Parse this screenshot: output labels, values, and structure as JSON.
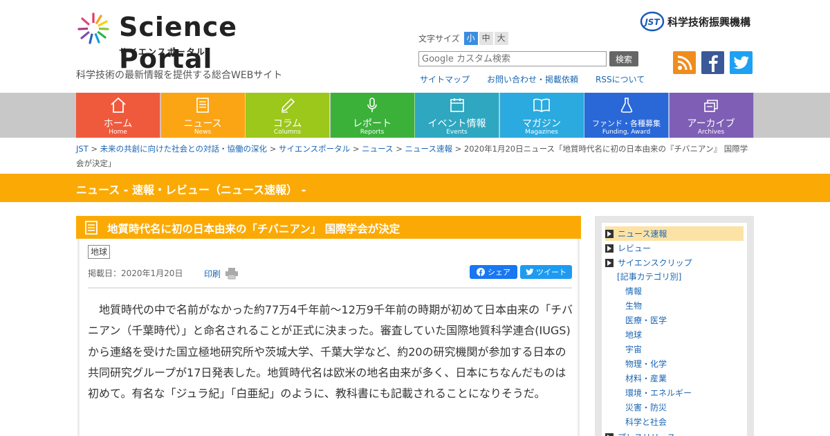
{
  "header": {
    "logo_text": "Science Portal",
    "logo_kana": "サイエンスポータル",
    "tagline": "科学技術の最新情報を提供する総合WEBサイト",
    "org_name": "科学技術振興機構",
    "org_badge": "JST",
    "font_size": {
      "label": "文字サイズ",
      "small": "小",
      "medium": "中",
      "large": "大",
      "active": "small"
    },
    "search": {
      "placeholder": "Google カスタム検索",
      "button": "検索"
    },
    "links": [
      "サイトマップ",
      "お問い合わせ・掲載依頼",
      "RSSについて"
    ],
    "social": [
      "rss-icon",
      "facebook-icon",
      "twitter-icon"
    ]
  },
  "nav": [
    {
      "jp": "ホーム",
      "en": "Home",
      "color": "#f05a3c",
      "icon": "home-icon"
    },
    {
      "jp": "ニュース",
      "en": "News",
      "color": "#fba515",
      "icon": "news-icon"
    },
    {
      "jp": "コラム",
      "en": "Columns",
      "color": "#9cc71b",
      "icon": "pencil-icon"
    },
    {
      "jp": "レポート",
      "en": "Reports",
      "color": "#3bb13a",
      "icon": "microphone-icon"
    },
    {
      "jp": "イベント情報",
      "en": "Events",
      "color": "#2fa7c0",
      "icon": "calendar-icon"
    },
    {
      "jp": "マガジン",
      "en": "Magazines",
      "color": "#2aaadf",
      "icon": "book-icon"
    },
    {
      "jp": "ファンド・各種募集",
      "en": "Funding, Award",
      "color": "#2a68d8",
      "icon": "flask-icon"
    },
    {
      "jp": "アーカイブ",
      "en": "Archives",
      "color": "#7e5fb5",
      "icon": "archive-icon"
    }
  ],
  "breadcrumb": {
    "links": [
      "JST",
      "未来の共創に向けた社会との対話・協働の深化",
      "サイエンスポータル",
      "ニュース",
      "ニュース速報"
    ],
    "current": "2020年1月20日ニュース「地質時代名に初の日本由来の『チバニアン』 国際学会が決定」"
  },
  "section_title": "ニュース - 速報・レビュー（ニュース速報） -",
  "article": {
    "title": "地質時代名に初の日本由来の「チバニアン」 国際学会が決定",
    "tag": "地球",
    "date": "掲載日：2020年1月20日",
    "print": "印刷",
    "share_fb": "シェア",
    "share_tw": "ツイート",
    "lead": "地質時代の中で名前がなかった約77万4千年前～12万9千年前の時期が初めて日本由来の「チバニアン（千葉時代）」と命名されることが正式に決まった。審査していた国際地質科学連合(IUGS)から連絡を受けた国立極地研究所や茨城大学、千葉大学など、約20の研究機関が参加する日本の共同研究グループが17日発表した。地質時代名は欧米の地名由来が多く、日本にちなんだものは初めて。有名な「ジュラ紀」「白亜紀」のように、教科書にも記載されることになりそうだ。"
  },
  "sidebar": {
    "items": [
      {
        "label": "ニュース速報",
        "active": true
      },
      {
        "label": "レビュー",
        "active": false
      },
      {
        "label": "サイエンスクリップ",
        "active": false
      }
    ],
    "category_heading": "[記事カテゴリ別]",
    "categories": [
      "情報",
      "生物",
      "医療・医学",
      "地球",
      "宇宙",
      "物理・化学",
      "材料・産業",
      "環境・エネルギー",
      "災害・防災",
      "科学と社会"
    ],
    "more": "プレスリリース"
  }
}
